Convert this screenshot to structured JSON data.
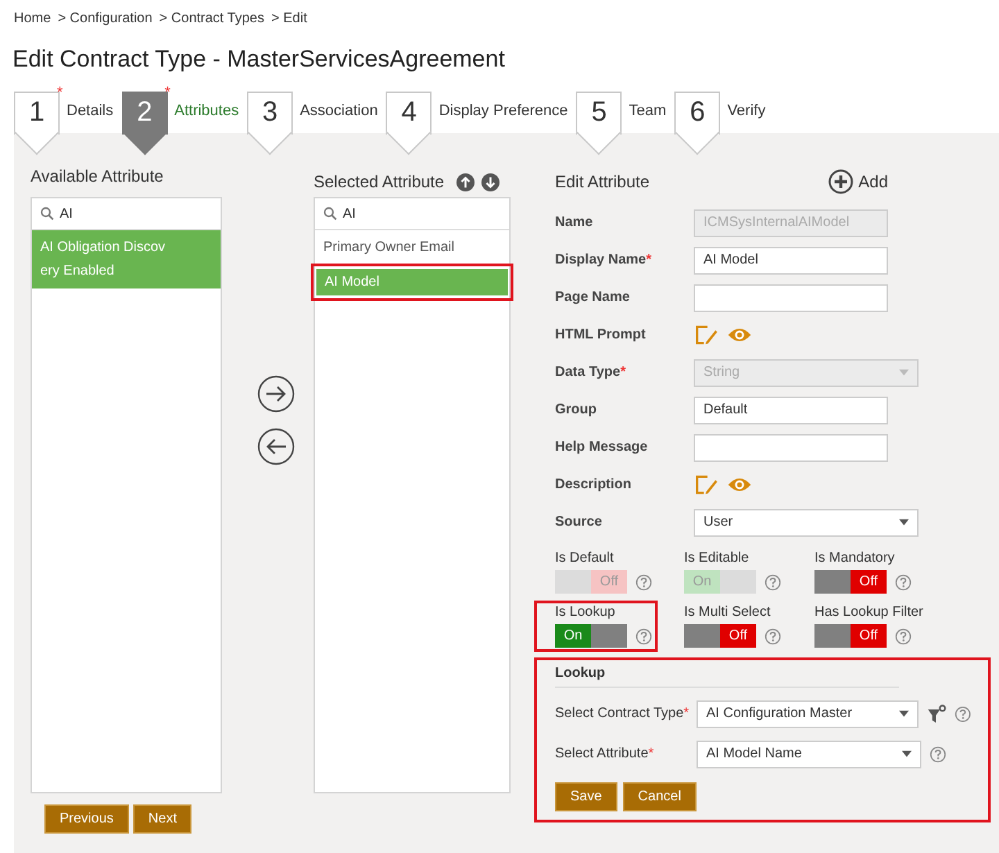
{
  "breadcrumb": [
    "Home",
    "> Configuration",
    "> Contract Types",
    "> Edit"
  ],
  "title": "Edit Contract Type - MasterServicesAgreement",
  "steps": [
    {
      "number": "1",
      "label": "Details",
      "mark": "*",
      "selected": false
    },
    {
      "number": "2",
      "label": "Attributes",
      "mark": "*",
      "selected": true
    },
    {
      "number": "3",
      "label": "Association",
      "selected": false
    },
    {
      "number": "4",
      "label": "Display Preference",
      "selected": false
    },
    {
      "number": "5",
      "label": "Team",
      "selected": false
    },
    {
      "number": "6",
      "label": "Verify",
      "selected": false
    }
  ],
  "available": {
    "heading": "Available Attribute",
    "search": "AI",
    "items": [
      {
        "lines": [
          "AI Obligation Discov",
          "ery Enabled"
        ],
        "selected": true,
        "highlighted": false
      }
    ]
  },
  "selected_list": {
    "heading": "Selected Attribute",
    "search": "AI",
    "items": [
      {
        "lines": [
          "Primary Owner Email"
        ],
        "selected": false,
        "highlighted": false
      },
      {
        "lines": [
          "AI Model"
        ],
        "selected": true,
        "highlighted": true
      }
    ]
  },
  "edit": {
    "heading": "Edit  Attribute",
    "add_label": "Add",
    "fields": [
      {
        "kind": "text",
        "label": "Name",
        "value": "ICMSysInternalAIModel",
        "disabled": true,
        "required": false
      },
      {
        "kind": "text",
        "label": "Display Name",
        "value": "AI Model",
        "disabled": false,
        "required": true
      },
      {
        "kind": "text",
        "label": "Page Name",
        "disabled": false,
        "required": false
      },
      {
        "kind": "icons",
        "label": "HTML Prompt",
        "required": false
      },
      {
        "kind": "select",
        "label": "Data Type",
        "value": "String",
        "disabled": true,
        "required": true
      },
      {
        "kind": "text",
        "label": "Group",
        "value": "Default",
        "disabled": false,
        "required": false
      },
      {
        "kind": "text",
        "label": "Help Message",
        "disabled": false,
        "required": false
      },
      {
        "kind": "icons",
        "label": "Description",
        "required": false
      },
      {
        "kind": "select",
        "label": "Source",
        "value": "User",
        "disabled": false,
        "required": false
      }
    ],
    "toggles": [
      {
        "label": "Is Default",
        "on": false,
        "state_label": "Off",
        "disabled": true,
        "highlighted": false
      },
      {
        "label": "Is Editable",
        "on": true,
        "state_label": "On",
        "disabled": true,
        "highlighted": false
      },
      {
        "label": "Is Mandatory",
        "on": false,
        "state_label": "Off",
        "disabled": false,
        "highlighted": false
      },
      {
        "label": "Is Lookup",
        "on": true,
        "state_label": "On",
        "disabled": false,
        "highlighted": true
      },
      {
        "label": "Is Multi Select",
        "on": false,
        "state_label": "Off",
        "disabled": false,
        "highlighted": false
      },
      {
        "label": "Has Lookup Filter",
        "on": false,
        "state_label": "Off",
        "disabled": false,
        "highlighted": false
      }
    ],
    "lookup": {
      "heading": "Lookup",
      "highlighted": true,
      "fields": [
        {
          "label": "Select Contract Type",
          "required": true,
          "value": "AI Configuration Master",
          "filter": true
        },
        {
          "label": "Select Attribute",
          "required": true,
          "value": "AI Model Name",
          "filter": false
        }
      ],
      "buttons": [
        "Save",
        "Cancel"
      ]
    }
  },
  "footer_buttons": [
    "Previous",
    "Next"
  ]
}
